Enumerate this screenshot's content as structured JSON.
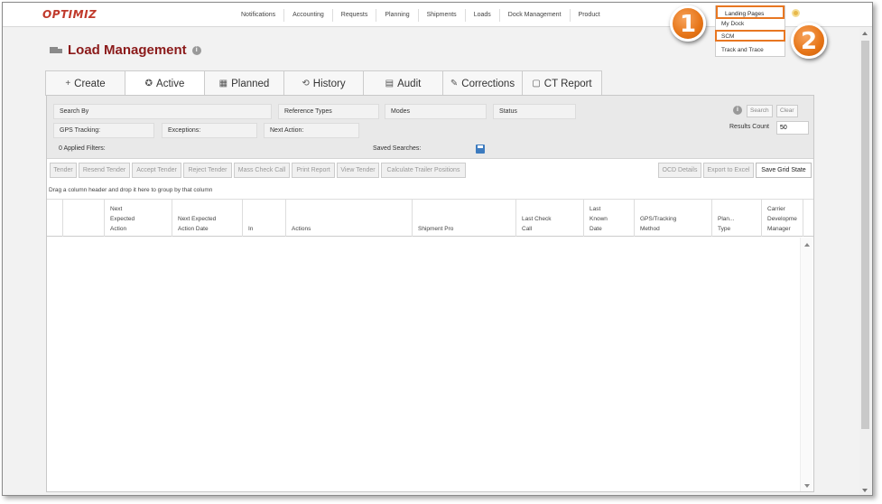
{
  "app": {
    "logo": "OPTIMIZ"
  },
  "topnav": {
    "items": [
      "Notifications",
      "Accounting",
      "Requests",
      "Planning",
      "Shipments",
      "Loads",
      "Dock Management",
      "Product"
    ]
  },
  "dropdown": {
    "items": [
      "Landing Pages",
      "My Dock",
      "SCM",
      "Track and Trace"
    ]
  },
  "callouts": [
    "1",
    "2"
  ],
  "page": {
    "title": "Load Management",
    "info_icon": "i"
  },
  "tabs": [
    {
      "label": "Create",
      "icon": "+"
    },
    {
      "label": "Active",
      "icon": "✪"
    },
    {
      "label": "Planned",
      "icon": "▦"
    },
    {
      "label": "History",
      "icon": "⟲"
    },
    {
      "label": "Audit",
      "icon": "▤"
    },
    {
      "label": "Corrections",
      "icon": "✎"
    },
    {
      "label": "CT Report",
      "icon": "▢"
    }
  ],
  "filters": {
    "search_by": "Search By",
    "reference_types": "Reference Types",
    "modes": "Modes",
    "status": "Status",
    "gps_tracking": "GPS Tracking:",
    "exceptions": "Exceptions:",
    "next_action": "Next Action:",
    "applied_filters": "0 Applied Filters:",
    "saved_searches": "Saved Searches:",
    "search_button": "Search",
    "clear_button": "Clear",
    "results_count_label": "Results Count",
    "results_count_value": "50"
  },
  "toolbar": {
    "tender": "Tender",
    "resend_tender": "Resend Tender",
    "accept_tender": "Accept Tender",
    "reject_tender": "Reject Tender",
    "mass_check_call": "Mass Check Call",
    "print_report": "Print Report",
    "view_tender": "View Tender",
    "calculate_trailer_positions": "Calculate Trailer Positions",
    "ocd_details": "OCD Details",
    "export_to_excel": "Export to Excel",
    "save_grid_state": "Save Grid State"
  },
  "grid": {
    "group_hint": "Drag a column header and drop it here to group by that column",
    "columns": [
      "",
      "",
      "Next\nExpected\nAction",
      "Next Expected\nAction Date",
      "In",
      "Actions",
      "Shipment Pro",
      "Last Check\nCall",
      "Last\nKnown\nDate",
      "GPS/Tracking\nMethod",
      "Plan...\nType",
      "Carrier\nDevelopme\nManager"
    ]
  }
}
